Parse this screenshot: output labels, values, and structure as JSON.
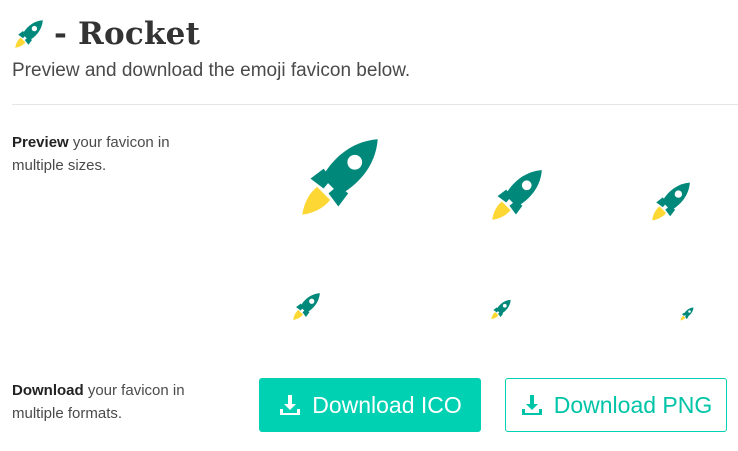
{
  "header": {
    "icon": "rocket-icon",
    "title": "- Rocket",
    "subtitle": "Preview and download the emoji favicon below."
  },
  "preview": {
    "label_bold": "Preview",
    "label_rest": " your favicon in multiple sizes.",
    "icons": [
      "rocket-icon",
      "rocket-icon",
      "rocket-icon",
      "rocket-icon",
      "rocket-icon",
      "rocket-icon"
    ]
  },
  "download": {
    "label_bold": "Download",
    "label_rest": " your favicon in multiple formats.",
    "ico_label": "Download ICO",
    "png_label": "Download PNG",
    "button_icon": "download-icon"
  },
  "colors": {
    "accent": "#00d1b2",
    "rocket_body": "#00897b",
    "rocket_flame": "#fdd835"
  }
}
